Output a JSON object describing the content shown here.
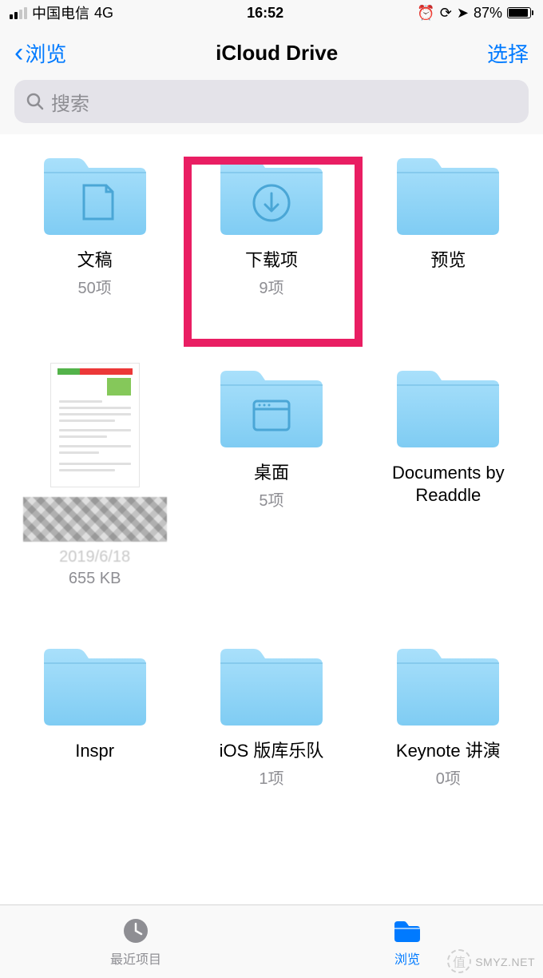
{
  "status_bar": {
    "carrier": "中国电信",
    "network": "4G",
    "time": "16:52",
    "battery_percent": "87%"
  },
  "nav": {
    "back_label": "浏览",
    "title": "iCloud Drive",
    "select_label": "选择"
  },
  "search": {
    "placeholder": "搜索"
  },
  "folders": [
    {
      "name": "文稿",
      "meta": "50项",
      "icon": "document"
    },
    {
      "name": "下载项",
      "meta": "9项",
      "icon": "download"
    },
    {
      "name": "预览",
      "meta": "",
      "icon": "plain"
    },
    {
      "name": "",
      "meta_date": "2019/6/18",
      "meta_size": "655 KB",
      "icon": "file"
    },
    {
      "name": "桌面",
      "meta": "5项",
      "icon": "window"
    },
    {
      "name": "Documents by Readdle",
      "meta": "",
      "icon": "plain"
    },
    {
      "name": "Inspr",
      "meta": "",
      "icon": "plain"
    },
    {
      "name": "iOS 版库乐队",
      "meta": "1项",
      "icon": "plain"
    },
    {
      "name": "Keynote 讲演",
      "meta": "0项",
      "icon": "plain"
    }
  ],
  "tabs": {
    "recent": "最近项目",
    "browse": "浏览"
  },
  "watermark": {
    "badge": "值",
    "text": "SMYZ.NET"
  },
  "colors": {
    "accent": "#007aff",
    "folder": "#8fd3f4",
    "highlight": "#e91e63"
  }
}
